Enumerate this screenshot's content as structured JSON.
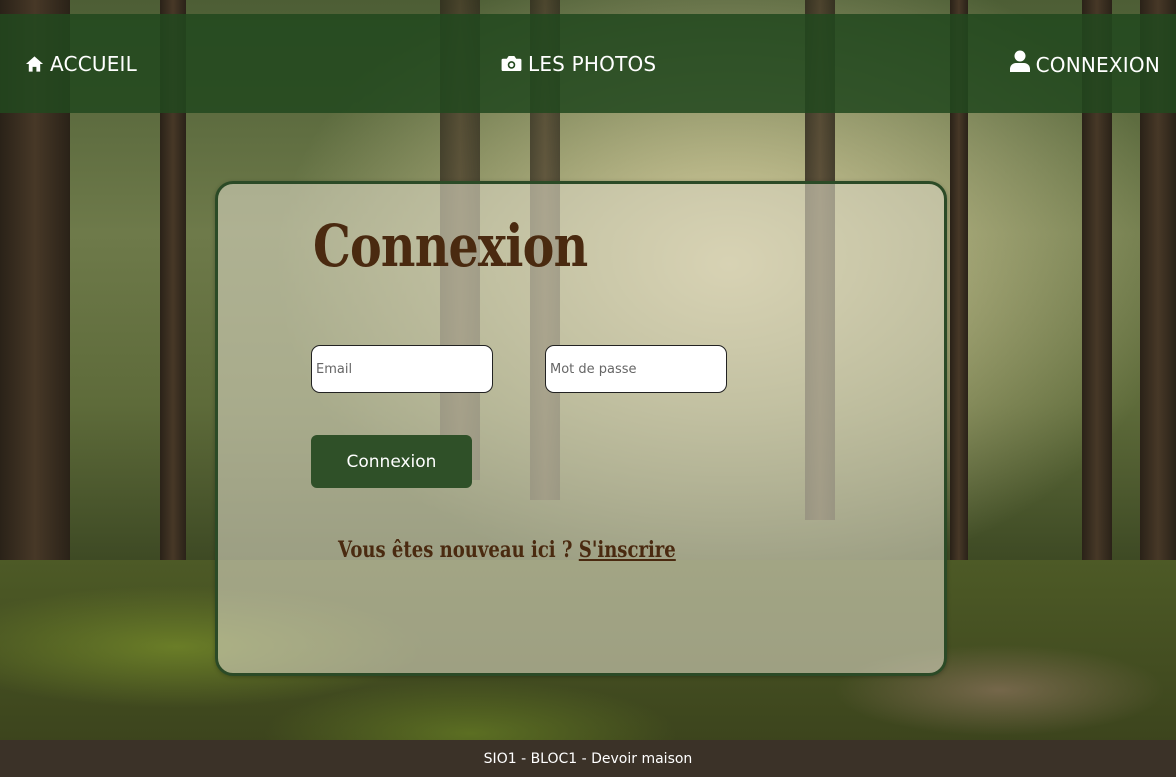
{
  "nav": {
    "home_label": "ACCUEIL",
    "home_icon": "home-icon",
    "photos_label": "LES PHOTOS",
    "photos_icon": "camera-icon",
    "login_label": "CONNEXION",
    "login_icon": "user-icon"
  },
  "login_form": {
    "title": "Connexion",
    "email_placeholder": "Email",
    "password_placeholder": "Mot de passe",
    "submit_label": "Connexion",
    "signup_prompt": "Vous êtes nouveau ici ? ",
    "signup_link": "S'inscrire"
  },
  "footer": {
    "text": "SIO1 - BLOC1 - Devoir maison"
  },
  "colors": {
    "header_bg": "#22481e",
    "button_bg": "#2f5028",
    "title_color": "#4a2a10",
    "footer_bg": "#3b3228"
  }
}
